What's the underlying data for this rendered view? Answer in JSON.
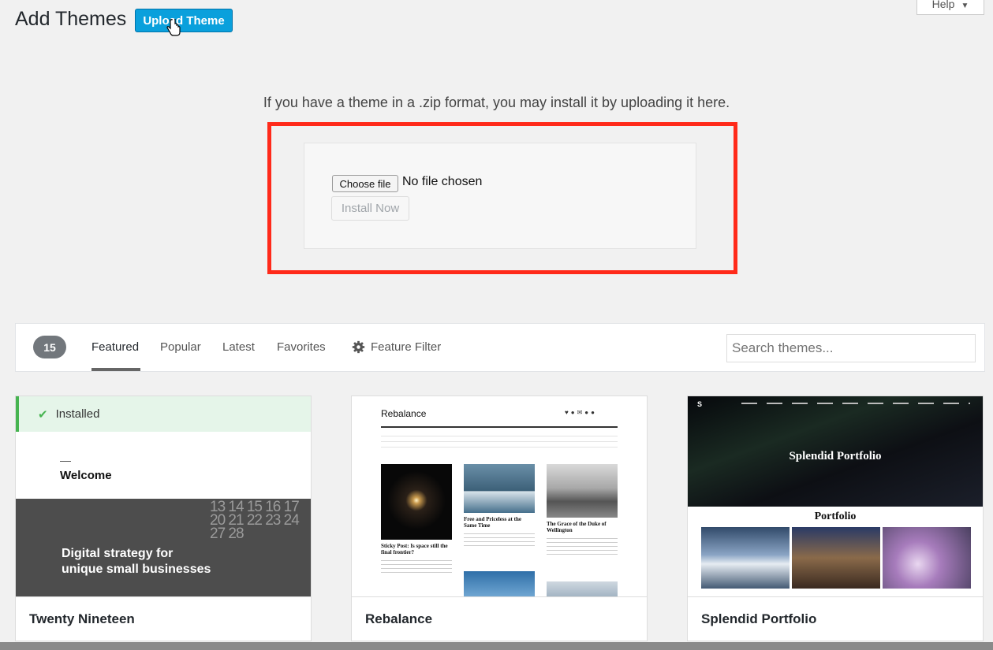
{
  "header": {
    "title": "Add Themes",
    "upload_label": "Upload Theme",
    "help_label": "Help"
  },
  "upload": {
    "description": "If you have a theme in a .zip format, you may install it by uploading it here.",
    "choose_label": "Choose file",
    "no_file_text": "No file chosen",
    "install_label": "Install Now",
    "highlight_color": "#ff2a1a"
  },
  "filter": {
    "count": "15",
    "tabs": [
      {
        "label": "Featured",
        "active": true
      },
      {
        "label": "Popular",
        "active": false
      },
      {
        "label": "Latest",
        "active": false
      },
      {
        "label": "Favorites",
        "active": false
      }
    ],
    "feature_filter_label": "Feature Filter",
    "search_placeholder": "Search themes..."
  },
  "themes": [
    {
      "name": "Twenty Nineteen",
      "installed_label": "Installed",
      "preview_heading": "Welcome",
      "preview_tagline_1": "Digital strategy for",
      "preview_tagline_2": "unique small businesses",
      "calendar_row_1": "13 14 15 16 17",
      "calendar_row_2": "20 21 22 23 24",
      "calendar_row_3": "27 28"
    },
    {
      "name": "Rebalance",
      "preview_title": "Rebalance",
      "post_1": "Sticky Post: Is space still the final frontier?",
      "post_2": "Free and Priceless at the Same Time",
      "post_3": "The Grace of the Duke of Wellington"
    },
    {
      "name": "Splendid Portfolio",
      "preview_title": "Splendid Portfolio",
      "preview_section": "Portfolio"
    }
  ],
  "colors": {
    "upload_button": "#0aa0dc",
    "installed_accent": "#46b450",
    "count_badge": "#72777c"
  }
}
